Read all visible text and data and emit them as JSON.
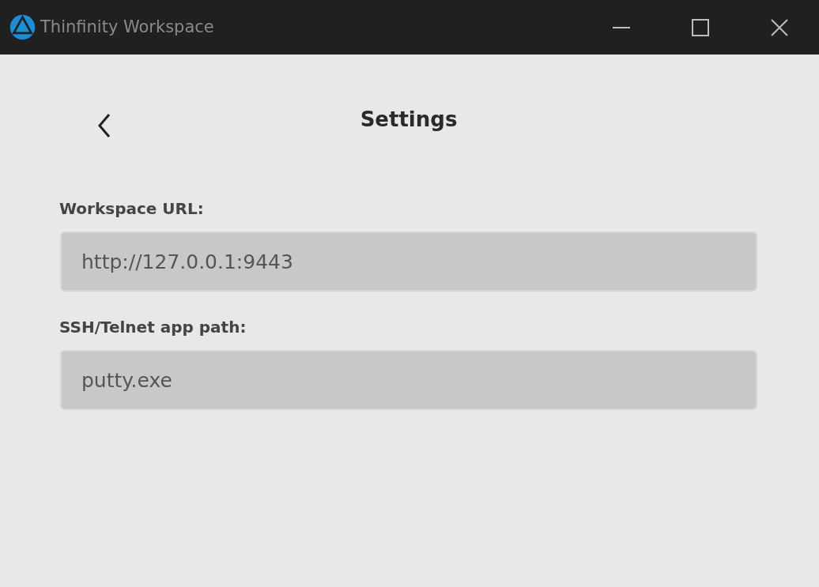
{
  "window": {
    "title": "Thinfinity Workspace"
  },
  "header": {
    "title": "Settings"
  },
  "fields": [
    {
      "label": "Workspace URL:",
      "value": "http://127.0.0.1:9443"
    },
    {
      "label": "SSH/Telnet app path:",
      "value": "putty.exe"
    }
  ]
}
